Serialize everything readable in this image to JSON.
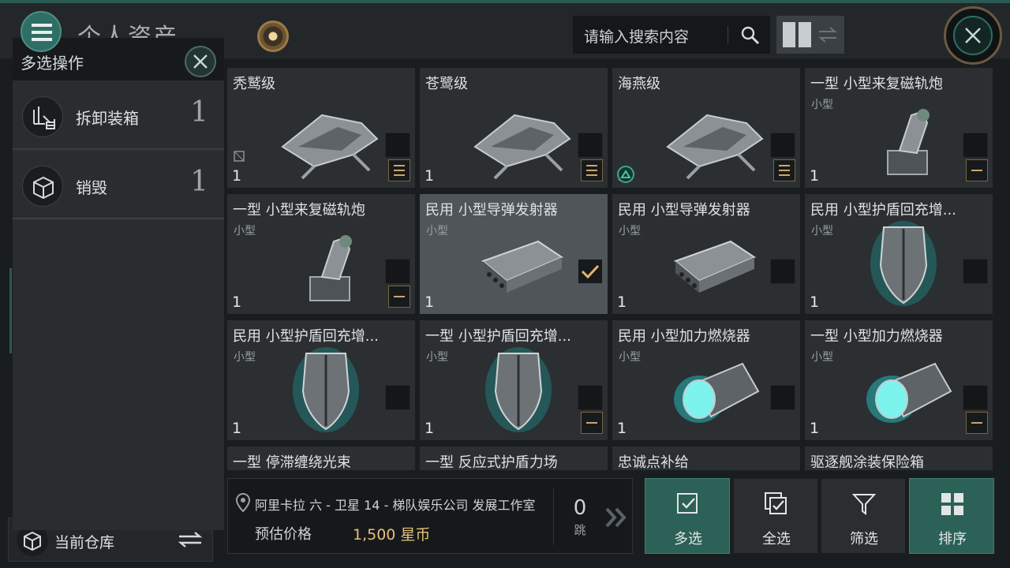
{
  "header": {
    "title": "个人资产",
    "search_placeholder": "请输入搜索内容"
  },
  "panel": {
    "title": "多选操作",
    "operations": [
      {
        "label": "拆卸装箱",
        "count": "1",
        "icon": "repackage-icon"
      },
      {
        "label": "销毁",
        "count": "1",
        "icon": "destroy-icon"
      }
    ]
  },
  "items": [
    {
      "name": "秃鹫级",
      "size": "",
      "qty": "1",
      "icon": "frigate-ship",
      "selected": false
    },
    {
      "name": "苍鹭级",
      "size": "",
      "qty": "1",
      "icon": "frigate-ship",
      "selected": false
    },
    {
      "name": "海燕级",
      "size": "",
      "qty": "1",
      "icon": "frigate-ship",
      "selected": false
    },
    {
      "name": "一型 小型来复磁轨炮",
      "size": "小型",
      "qty": "1",
      "icon": "railgun",
      "selected": false
    },
    {
      "name": "一型 小型来复磁轨炮",
      "size": "小型",
      "qty": "1",
      "icon": "railgun",
      "selected": false
    },
    {
      "name": "民用 小型导弹发射器",
      "size": "小型",
      "qty": "1",
      "icon": "missile-launcher",
      "selected": true
    },
    {
      "name": "民用 小型导弹发射器",
      "size": "小型",
      "qty": "1",
      "icon": "missile-launcher",
      "selected": false
    },
    {
      "name": "民用 小型护盾回充增...",
      "size": "小型",
      "qty": "1",
      "icon": "shield",
      "selected": false
    },
    {
      "name": "民用 小型护盾回充增...",
      "size": "小型",
      "qty": "1",
      "icon": "shield",
      "selected": false
    },
    {
      "name": "一型 小型护盾回充增...",
      "size": "小型",
      "qty": "1",
      "icon": "shield",
      "selected": false
    },
    {
      "name": "民用 小型加力燃烧器",
      "size": "小型",
      "qty": "1",
      "icon": "afterburner",
      "selected": false
    },
    {
      "name": "一型 小型加力燃烧器",
      "size": "小型",
      "qty": "1",
      "icon": "afterburner",
      "selected": false
    },
    {
      "name": "一型 停滞缠绕光束",
      "size": "",
      "qty": "",
      "icon": "",
      "selected": false
    },
    {
      "name": "一型 反应式护盾力场",
      "size": "",
      "qty": "",
      "icon": "",
      "selected": false
    },
    {
      "name": "忠诚点补给",
      "size": "",
      "qty": "",
      "icon": "",
      "selected": false
    },
    {
      "name": "驱逐舰涂装保险箱",
      "size": "",
      "qty": "",
      "icon": "",
      "selected": false
    }
  ],
  "warehouse": {
    "label": "当前仓库"
  },
  "info": {
    "location": "阿里卡拉 六 - 卫星 14 - 梯队娱乐公司 发展工作室",
    "price_label": "预估价格",
    "price_value": "1,500 星币",
    "jumps": "0",
    "jumps_unit": "跳"
  },
  "actions": [
    {
      "label": "多选",
      "active": true
    },
    {
      "label": "全选",
      "active": false
    },
    {
      "label": "筛选",
      "active": false
    },
    {
      "label": "排序",
      "active": true
    }
  ],
  "colors": {
    "accent": "#2b6157",
    "price": "#e7c077"
  }
}
